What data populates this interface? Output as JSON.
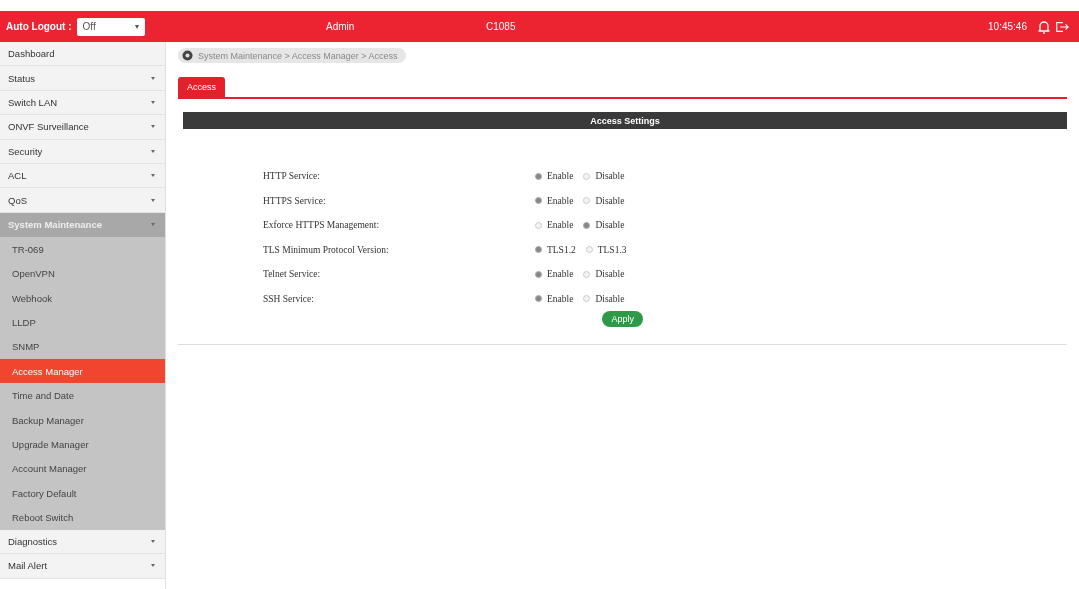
{
  "header": {
    "auto_logout": {
      "label": "Auto Logout :",
      "value": "Off"
    },
    "user": "Admin",
    "device": "C1085",
    "time": "10:45:46"
  },
  "sidebar": {
    "items": [
      {
        "label": "Dashboard",
        "expandable": false,
        "expanded": false
      },
      {
        "label": "Status",
        "expandable": true,
        "expanded": false
      },
      {
        "label": "Switch LAN",
        "expandable": true,
        "expanded": false
      },
      {
        "label": "ONVF Surveillance",
        "expandable": true,
        "expanded": false
      },
      {
        "label": "Security",
        "expandable": true,
        "expanded": false
      },
      {
        "label": "ACL",
        "expandable": true,
        "expanded": false
      },
      {
        "label": "QoS",
        "expandable": true,
        "expanded": false
      },
      {
        "label": "System Maintenance",
        "expandable": true,
        "expanded": true,
        "children": [
          {
            "label": "TR-069",
            "selected": false
          },
          {
            "label": "OpenVPN",
            "selected": false
          },
          {
            "label": "Webhook",
            "selected": false
          },
          {
            "label": "LLDP",
            "selected": false
          },
          {
            "label": "SNMP",
            "selected": false
          },
          {
            "label": "Access Manager",
            "selected": true
          },
          {
            "label": "Time and Date",
            "selected": false
          },
          {
            "label": "Backup Manager",
            "selected": false
          },
          {
            "label": "Upgrade Manager",
            "selected": false
          },
          {
            "label": "Account Manager",
            "selected": false
          },
          {
            "label": "Factory Default",
            "selected": false
          },
          {
            "label": "Reboot Switch",
            "selected": false
          }
        ]
      },
      {
        "label": "Diagnostics",
        "expandable": true,
        "expanded": false
      },
      {
        "label": "Mail Alert",
        "expandable": true,
        "expanded": false
      }
    ]
  },
  "breadcrumb": "System Maintenance > Access Manager > Access",
  "tabs": [
    {
      "label": "Access",
      "selected": true
    }
  ],
  "section_title": "Access Settings",
  "settings": [
    {
      "label": "HTTP Service:",
      "options": [
        {
          "label": "Enable",
          "selected": true
        },
        {
          "label": "Disable",
          "selected": false
        }
      ]
    },
    {
      "label": "HTTPS Service:",
      "options": [
        {
          "label": "Enable",
          "selected": true
        },
        {
          "label": "Disable",
          "selected": false
        }
      ]
    },
    {
      "label": "Exforce HTTPS Management:",
      "options": [
        {
          "label": "Enable",
          "selected": false
        },
        {
          "label": "Disable",
          "selected": true
        }
      ]
    },
    {
      "label": "TLS Minimum Protocol Version:",
      "options": [
        {
          "label": "TLS1.2",
          "selected": true
        },
        {
          "label": "TLS1.3",
          "selected": false
        }
      ]
    },
    {
      "label": "Telnet Service:",
      "options": [
        {
          "label": "Enable",
          "selected": true
        },
        {
          "label": "Disable",
          "selected": false
        }
      ]
    },
    {
      "label": "SSH Service:",
      "options": [
        {
          "label": "Enable",
          "selected": true
        },
        {
          "label": "Disable",
          "selected": false
        }
      ]
    }
  ],
  "apply_button": "Apply"
}
